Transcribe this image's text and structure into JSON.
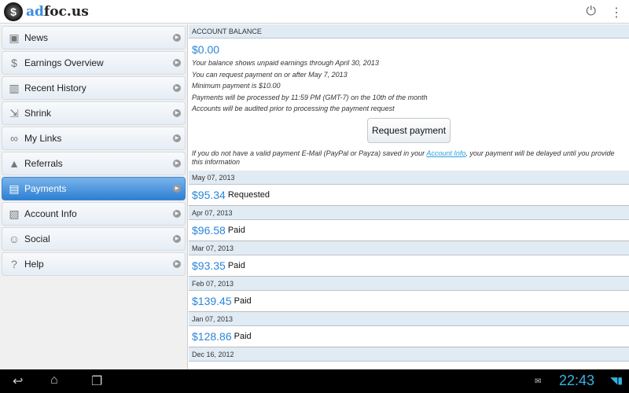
{
  "app": {
    "brand_ad": "ad",
    "brand_rest": "foc.us"
  },
  "sidebar": {
    "items": [
      {
        "label": "News",
        "icon": "news-icon",
        "glyph": "▣"
      },
      {
        "label": "Earnings Overview",
        "icon": "money-bag-icon",
        "glyph": "$"
      },
      {
        "label": "Recent History",
        "icon": "bar-chart-icon",
        "glyph": "▥"
      },
      {
        "label": "Shrink",
        "icon": "shrink-icon",
        "glyph": "⇲"
      },
      {
        "label": "My Links",
        "icon": "link-icon",
        "glyph": "∞"
      },
      {
        "label": "Referrals",
        "icon": "pyramid-icon",
        "glyph": "▲"
      },
      {
        "label": "Payments",
        "icon": "payments-icon",
        "glyph": "▤",
        "active": true
      },
      {
        "label": "Account Info",
        "icon": "document-icon",
        "glyph": "▧"
      },
      {
        "label": "Social",
        "icon": "people-icon",
        "glyph": "☺"
      },
      {
        "label": "Help",
        "icon": "help-icon",
        "glyph": "?"
      }
    ]
  },
  "balance": {
    "header": "ACCOUNT BALANCE",
    "amount": "$0.00",
    "notes": [
      "Your balance shows unpaid earnings through April 30, 2013",
      "You can request payment on or after May 7, 2013",
      "Minimum payment is $10.00",
      "Payments will be processed by 11:59 PM (GMT-7) on the 10th of the month",
      "Accounts will be audited prior to processing the payment request"
    ],
    "button": "Request payment",
    "warn_pre": "If you do not have a valid payment E-Mail (PayPal or Payza) saved in your ",
    "warn_link": "Account Info",
    "warn_post": ", your payment will be delayed until you provide this information"
  },
  "payments": [
    {
      "date": "May 07, 2013",
      "amount": "$95.34",
      "status": "Requested"
    },
    {
      "date": "Apr 07, 2013",
      "amount": "$96.58",
      "status": "Paid"
    },
    {
      "date": "Mar 07, 2013",
      "amount": "$93.35",
      "status": "Paid"
    },
    {
      "date": "Feb 07, 2013",
      "amount": "$139.45",
      "status": "Paid"
    },
    {
      "date": "Jan 07, 2013",
      "amount": "$128.86",
      "status": "Paid"
    },
    {
      "date": "Dec 16, 2012"
    }
  ],
  "status_bar": {
    "time": "22:43"
  }
}
